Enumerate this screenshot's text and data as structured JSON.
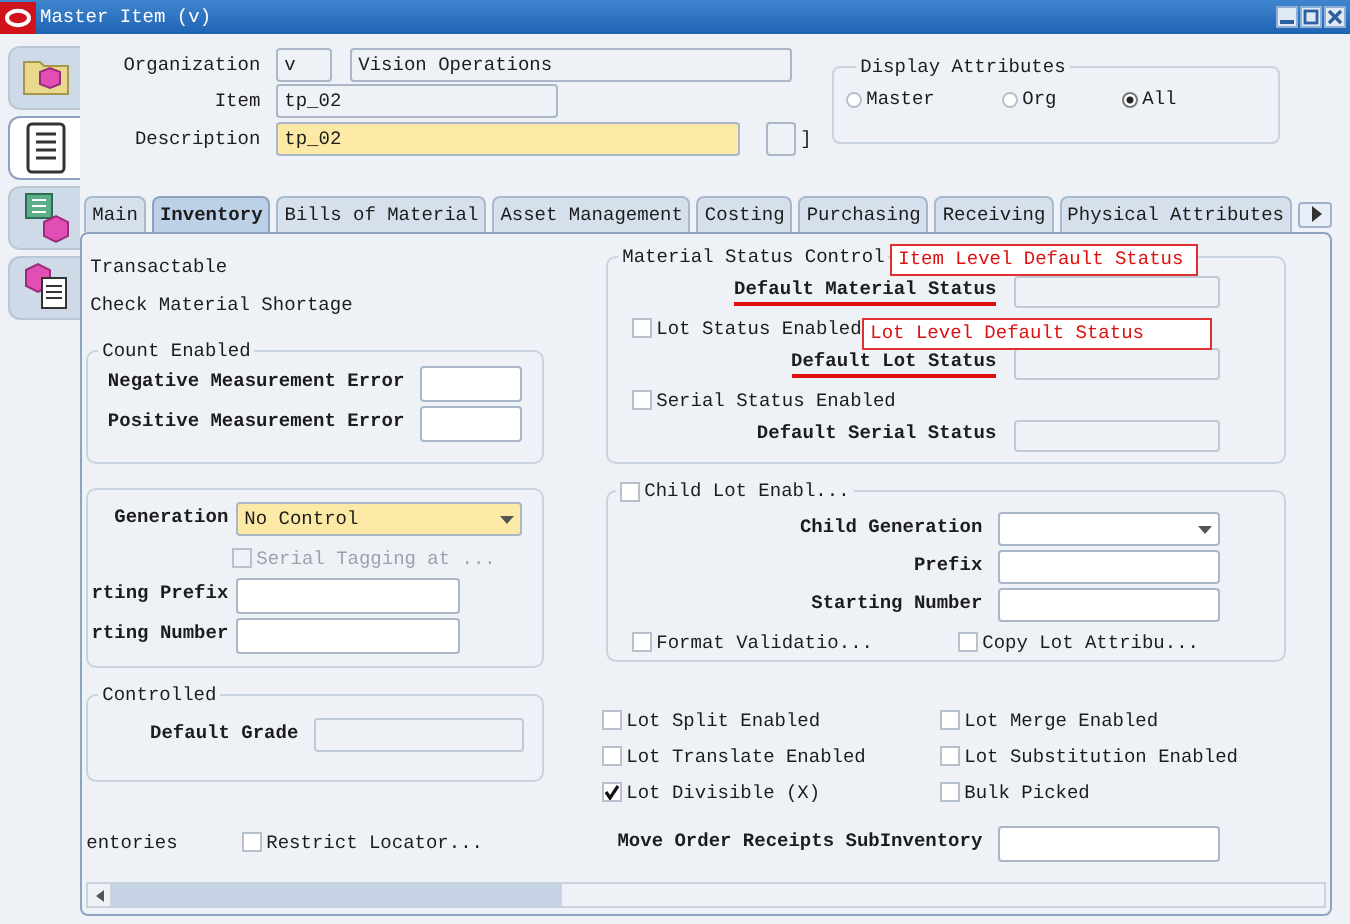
{
  "window": {
    "title": "Master Item (v)"
  },
  "side_tabs": [
    {
      "kind": "folder",
      "selected": false
    },
    {
      "kind": "list",
      "selected": true
    },
    {
      "kind": "window",
      "selected": false
    },
    {
      "kind": "cube-list",
      "selected": false
    }
  ],
  "header": {
    "organization": {
      "label": "Organization",
      "code": "v",
      "name": "Vision Operations"
    },
    "item": {
      "label": "Item",
      "value": "tp_02"
    },
    "description": {
      "label": "Description",
      "value": "tp_02",
      "required": true,
      "bracket": "]"
    },
    "display_attributes": {
      "title": "Display Attributes",
      "options": [
        {
          "label": "Master",
          "selected": false
        },
        {
          "label": "Org",
          "selected": false
        },
        {
          "label": "All",
          "selected": true
        }
      ]
    }
  },
  "tabs": [
    {
      "label": "Main",
      "selected": false
    },
    {
      "label": "Inventory",
      "selected": true
    },
    {
      "label": "Bills of Material",
      "selected": false
    },
    {
      "label": "Asset Management",
      "selected": false
    },
    {
      "label": "Costing",
      "selected": false
    },
    {
      "label": "Purchasing",
      "selected": false
    },
    {
      "label": "Receiving",
      "selected": false
    },
    {
      "label": "Physical Attributes",
      "selected": false
    }
  ],
  "inventory": {
    "left": [
      {
        "kind": "text",
        "label": "Transactable"
      },
      {
        "kind": "text",
        "label": "Check Material Shortage"
      },
      {
        "kind": "group",
        "title": "Count Enabled",
        "rows": [
          {
            "kind": "field",
            "label": "Negative Measurement Error"
          },
          {
            "kind": "field",
            "label": "Positive Measurement Error"
          }
        ]
      },
      {
        "kind": "group",
        "rows": [
          {
            "kind": "dropdown",
            "label": "Generation",
            "value": "No Control",
            "required": true
          },
          {
            "kind": "check",
            "label": "Serial Tagging at ...",
            "checked": false,
            "disabled": true
          },
          {
            "kind": "field",
            "label": "rting Prefix"
          },
          {
            "kind": "field",
            "label": "rting Number"
          }
        ]
      },
      {
        "kind": "group",
        "title": "Controlled",
        "rows": [
          {
            "kind": "field",
            "label": "Default Grade",
            "disabled": true
          }
        ]
      },
      {
        "kind": "split",
        "text": "entories",
        "check": {
          "label": "Restrict Locator...",
          "checked": false
        }
      }
    ],
    "right": [
      {
        "kind": "group",
        "title": "Material Status Control",
        "rows": [
          {
            "kind": "field",
            "label": "Default Material Status",
            "disabled": true,
            "marked": true
          },
          {
            "kind": "check",
            "label": "Lot Status Enabled",
            "checked": false
          },
          {
            "kind": "field",
            "label": "Default Lot Status",
            "disabled": true,
            "marked": true
          },
          {
            "kind": "check",
            "label": "Serial Status Enabled",
            "checked": false
          },
          {
            "kind": "field",
            "label": "Default Serial Status",
            "disabled": true
          }
        ]
      },
      {
        "kind": "group",
        "title_check": {
          "label": "Child Lot Enabl...",
          "checked": false
        },
        "rows": [
          {
            "kind": "dropdown",
            "label": "Child Generation"
          },
          {
            "kind": "field",
            "label": "Prefix"
          },
          {
            "kind": "field",
            "label": "Starting Number"
          },
          {
            "kind": "checks",
            "items": [
              {
                "label": "Format Validatio...",
                "checked": false
              },
              {
                "label": "Copy Lot Attribu...",
                "checked": false
              }
            ]
          }
        ]
      },
      {
        "kind": "checks",
        "items": [
          {
            "label": "Lot Split Enabled",
            "checked": false
          },
          {
            "label": "Lot Merge Enabled",
            "checked": false
          },
          {
            "label": "Lot Translate Enabled",
            "checked": false
          },
          {
            "label": "Lot Substitution Enabled",
            "checked": false
          },
          {
            "label": "Lot Divisible (X)",
            "checked": true
          },
          {
            "label": "Bulk Picked",
            "checked": false
          }
        ]
      },
      {
        "kind": "field",
        "label": "Move Order Receipts SubInventory"
      }
    ],
    "annotations": [
      {
        "text": "Item Level Default Status"
      },
      {
        "text": "Lot Level Default Status"
      }
    ]
  }
}
